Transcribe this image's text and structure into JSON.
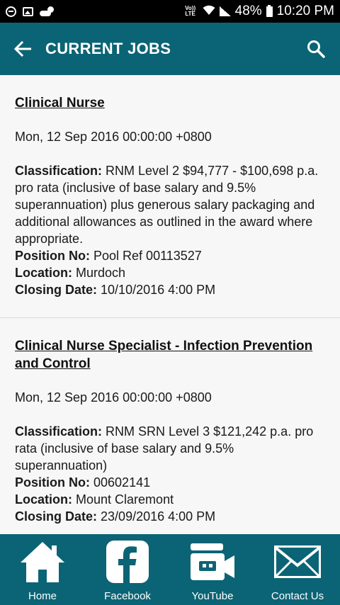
{
  "status_bar": {
    "volte": "Vo)) LTE",
    "battery": "48%",
    "time": "10:20 PM"
  },
  "app_bar": {
    "title": "CURRENT JOBS",
    "back_icon": "arrow-left-icon",
    "search_icon": "search-icon"
  },
  "jobs": [
    {
      "title": "Clinical Nurse",
      "date": "Mon, 12 Sep 2016 00:00:00 +0800",
      "classification_label": "Classification:",
      "classification": "RNM Level 2 $94,777 - $100,698 p.a. pro rata (inclusive of base salary and 9.5% superannuation) plus generous salary packaging and additional allowances as outlined in the award where appropriate.",
      "position_label": "Position No:",
      "position": "Pool Ref 00113527",
      "location_label": "Location:",
      "location": "Murdoch",
      "closing_label": "Closing Date:",
      "closing": "10/10/2016 4:00 PM"
    },
    {
      "title": "Clinical Nurse Specialist - Infection Prevention and Control",
      "date": "Mon, 12 Sep 2016 00:00:00 +0800",
      "classification_label": "Classification:",
      "classification": "RNM SRN Level 3 $121,242 p.a. pro rata (inclusive of base salary and 9.5% superannuation)",
      "position_label": "Position No:",
      "position": "00602141",
      "location_label": "Location:",
      "location": "Mount Claremont",
      "closing_label": "Closing Date:",
      "closing": "23/09/2016 4:00 PM"
    }
  ],
  "bottom_nav": {
    "items": [
      {
        "label": "Home",
        "icon": "home-icon"
      },
      {
        "label": "Facebook",
        "icon": "facebook-icon"
      },
      {
        "label": "YouTube",
        "icon": "video-camera-icon"
      },
      {
        "label": "Contact Us",
        "icon": "envelope-icon"
      }
    ]
  },
  "colors": {
    "primary": "#0b6475",
    "background": "#f7f7f7"
  }
}
